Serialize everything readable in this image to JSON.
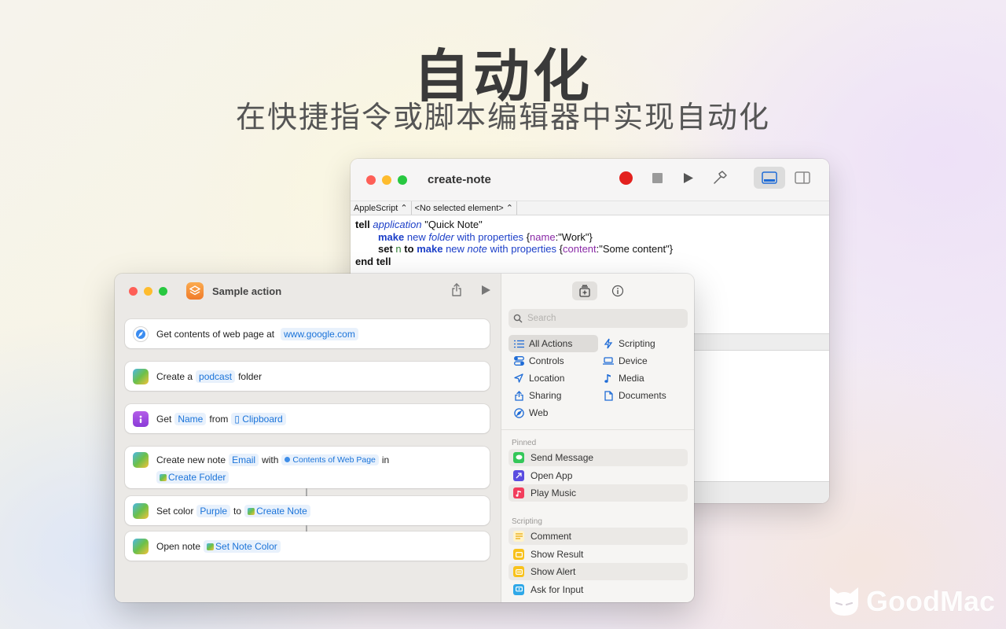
{
  "hero": {
    "title": "自动化",
    "subtitle": "在快捷指令或脚本编辑器中实现自动化"
  },
  "script_editor": {
    "title": "create-note",
    "language": "AppleScript",
    "element_selector": "<No selected element>",
    "toolbar": [
      "record-icon",
      "stop-icon",
      "run-icon",
      "compile-hammer-icon"
    ],
    "views": [
      "bottom-pane-icon",
      "side-pane-icon"
    ],
    "code": {
      "l1_kw": "tell",
      "l1_app": "application",
      "l1_str": "\"Quick Note\"",
      "l2_make": "make",
      "l2_new": "new",
      "l2_folder": "folder",
      "l2_with": "with properties",
      "l2_open": "{",
      "l2_prop": "name",
      "l2_val": ":\"Work\"}",
      "l3_set": "set",
      "l3_var": "n",
      "l3_to": "to",
      "l3_make": "make",
      "l3_new": "new",
      "l3_note": "note",
      "l3_with": "with properties",
      "l3_open": "{",
      "l3_prop": "content",
      "l3_val": ":\"Some content\"}",
      "l4_kw": "end tell"
    },
    "colors": {
      "record": "#e3211e",
      "keyword_blue": "#1c3fc8",
      "property": "#8a2aa7"
    }
  },
  "shortcuts": {
    "title": "Sample action",
    "actions": {
      "a1": {
        "text": "Get contents of web page at",
        "token": "www.google.com"
      },
      "a2": {
        "pre": "Create a",
        "token": "podcast",
        "post": "folder"
      },
      "a3": {
        "pre": "Get",
        "token1": "Name",
        "mid": "from",
        "token2": "Clipboard"
      },
      "a4": {
        "pre": "Create new note",
        "token1": "Email",
        "mid": "with",
        "token2": "Contents of Web Page",
        "post": "in",
        "token3": "Create Folder"
      },
      "a5": {
        "pre": "Set color",
        "token1": "Purple",
        "mid": "to",
        "token2": "Create Note"
      },
      "a6": {
        "pre": "Open note",
        "token": "Set Note Color"
      }
    },
    "sidebar": {
      "search_placeholder": "Search",
      "categories": [
        "All Actions",
        "Scripting",
        "Controls",
        "Device",
        "Location",
        "Media",
        "Sharing",
        "Documents",
        "Web"
      ],
      "pinned_header": "Pinned",
      "pinned": [
        "Send Message",
        "Open App",
        "Play Music"
      ],
      "scripting_header": "Scripting",
      "scripting": [
        "Comment",
        "Show Result",
        "Show Alert",
        "Ask for Input"
      ]
    }
  },
  "watermark": {
    "text": "GoodMac"
  }
}
